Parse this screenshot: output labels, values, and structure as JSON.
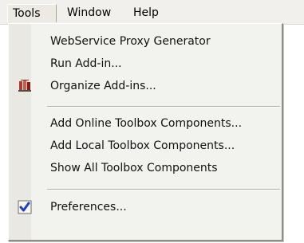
{
  "menubar": {
    "items": [
      {
        "label": "Tools"
      },
      {
        "label": "Window"
      },
      {
        "label": "Help"
      }
    ]
  },
  "dropdown": {
    "items": [
      {
        "label": "WebService Proxy Generator"
      },
      {
        "label": "Run Add-in..."
      },
      {
        "label": "Organize Add-ins...",
        "icon": "organize-addins-icon"
      },
      {
        "label": "Add Online Toolbox Components..."
      },
      {
        "label": "Add Local Toolbox Components..."
      },
      {
        "label": "Show All Toolbox Components"
      },
      {
        "label": "Preferences...",
        "icon": "checkmark-icon"
      }
    ]
  },
  "colors": {
    "menu_bg": "#f2f2ef",
    "menubar_bg": "#f1f0ec",
    "text": "#111111",
    "check_blue": "#1f3fbf",
    "icon_red": "#b53a2d"
  }
}
